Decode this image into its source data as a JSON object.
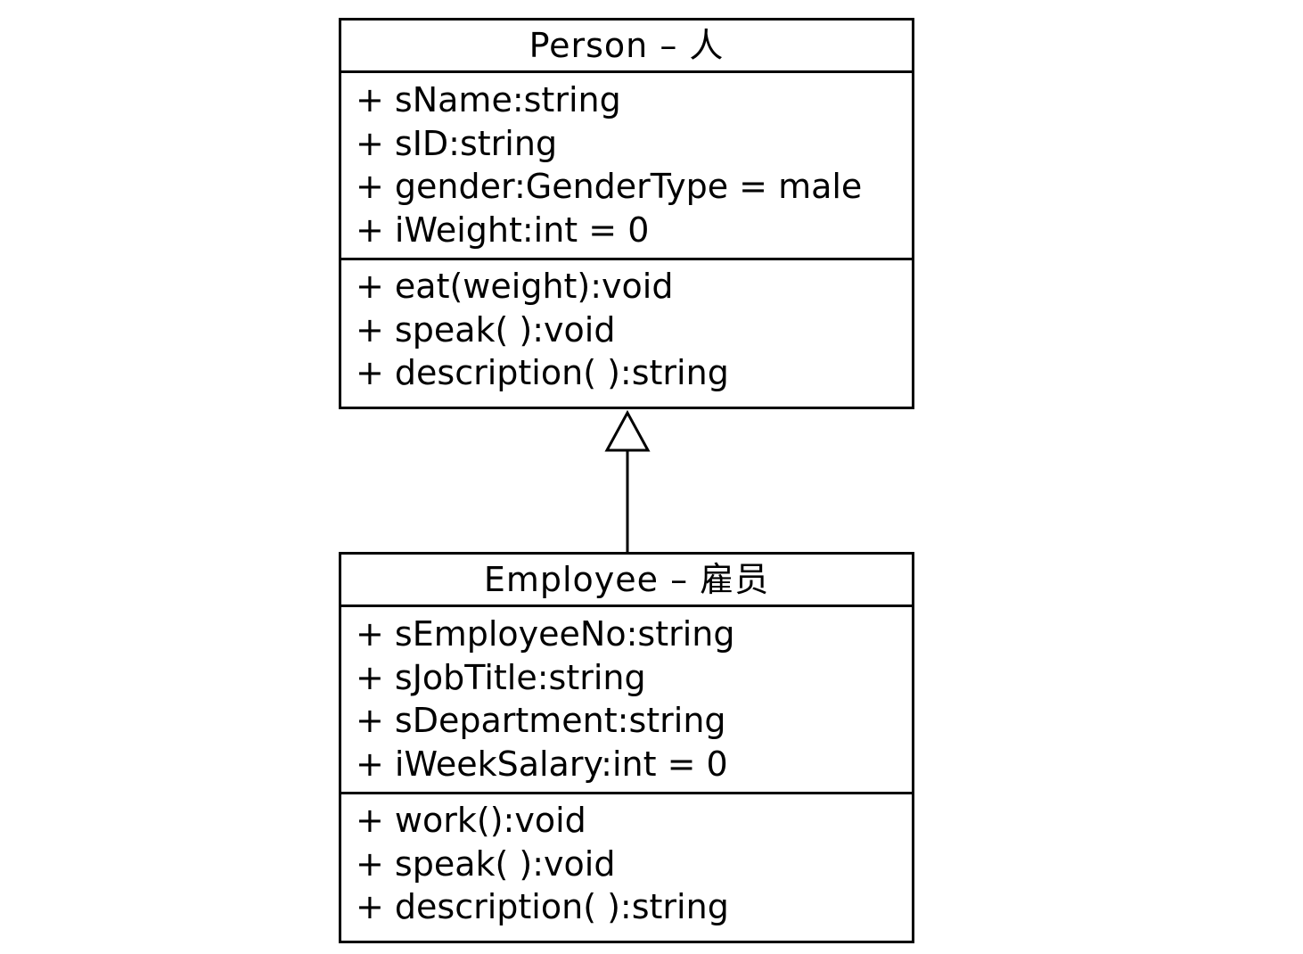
{
  "classes": {
    "person": {
      "name": "Person – 人",
      "attributes": [
        "+ sName:string",
        "+ sID:string",
        "+ gender:GenderType = male",
        "+ iWeight:int = 0"
      ],
      "methods": [
        "+ eat(weight):void",
        "+ speak( ):void",
        "+ description( ):string"
      ]
    },
    "employee": {
      "name": "Employee – 雇员",
      "attributes": [
        "+ sEmployeeNo:string",
        "+ sJobTitle:string",
        "+ sDepartment:string",
        "+ iWeekSalary:int = 0"
      ],
      "methods": [
        "+ work():void",
        "+ speak( ):void",
        "+ description( ):string"
      ]
    }
  },
  "relationships": [
    {
      "type": "generalization",
      "from": "employee",
      "to": "person"
    }
  ],
  "colors": {
    "line": "#000000",
    "background": "#ffffff"
  }
}
